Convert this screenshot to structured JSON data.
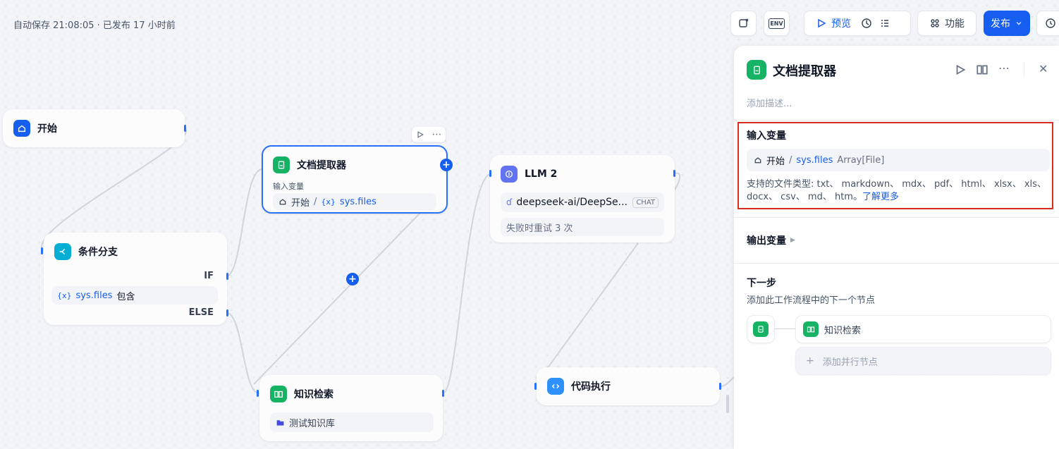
{
  "status_text": "自动保存 21:08:05 · 已发布 17 小时前",
  "toolbar": {
    "preview_label": "预览",
    "features_label": "功能",
    "publish_label": "发布",
    "env_label": "ENV"
  },
  "nodes": {
    "start": {
      "title": "开始"
    },
    "ifelse": {
      "title": "条件分支",
      "if_label": "IF",
      "else_label": "ELSE",
      "cond_var": "sys.files",
      "cond_op": "包含"
    },
    "doc": {
      "title": "文档提取器",
      "input_label": "输入变量",
      "src": "开始",
      "var": "sys.files"
    },
    "llm": {
      "title": "LLM 2",
      "model": "deepseek-ai/DeepSe...",
      "mode": "CHAT",
      "retry": "失败时重试 3 次"
    },
    "knowledge": {
      "title": "知识检索",
      "dataset": "测试知识库"
    },
    "code": {
      "title": "代码执行"
    }
  },
  "panel": {
    "title": "文档提取器",
    "desc_placeholder": "添加描述...",
    "input_title": "输入变量",
    "input_src": "开始",
    "input_var": "sys.files",
    "input_type": "Array[File]",
    "supported_text": "支持的文件类型: txt、 markdown、 mdx、 pdf、 html、 xlsx、 xls、 docx、 csv、 md、 htm。",
    "learn_more": "了解更多",
    "output_title": "输出变量",
    "next_title": "下一步",
    "next_desc": "添加此工作流程中的下一个节点",
    "next_node": "知识检索",
    "add_parallel": "添加并行节点"
  },
  "colors": {
    "accent": "#155eef",
    "highlight_border": "#d92d20"
  }
}
